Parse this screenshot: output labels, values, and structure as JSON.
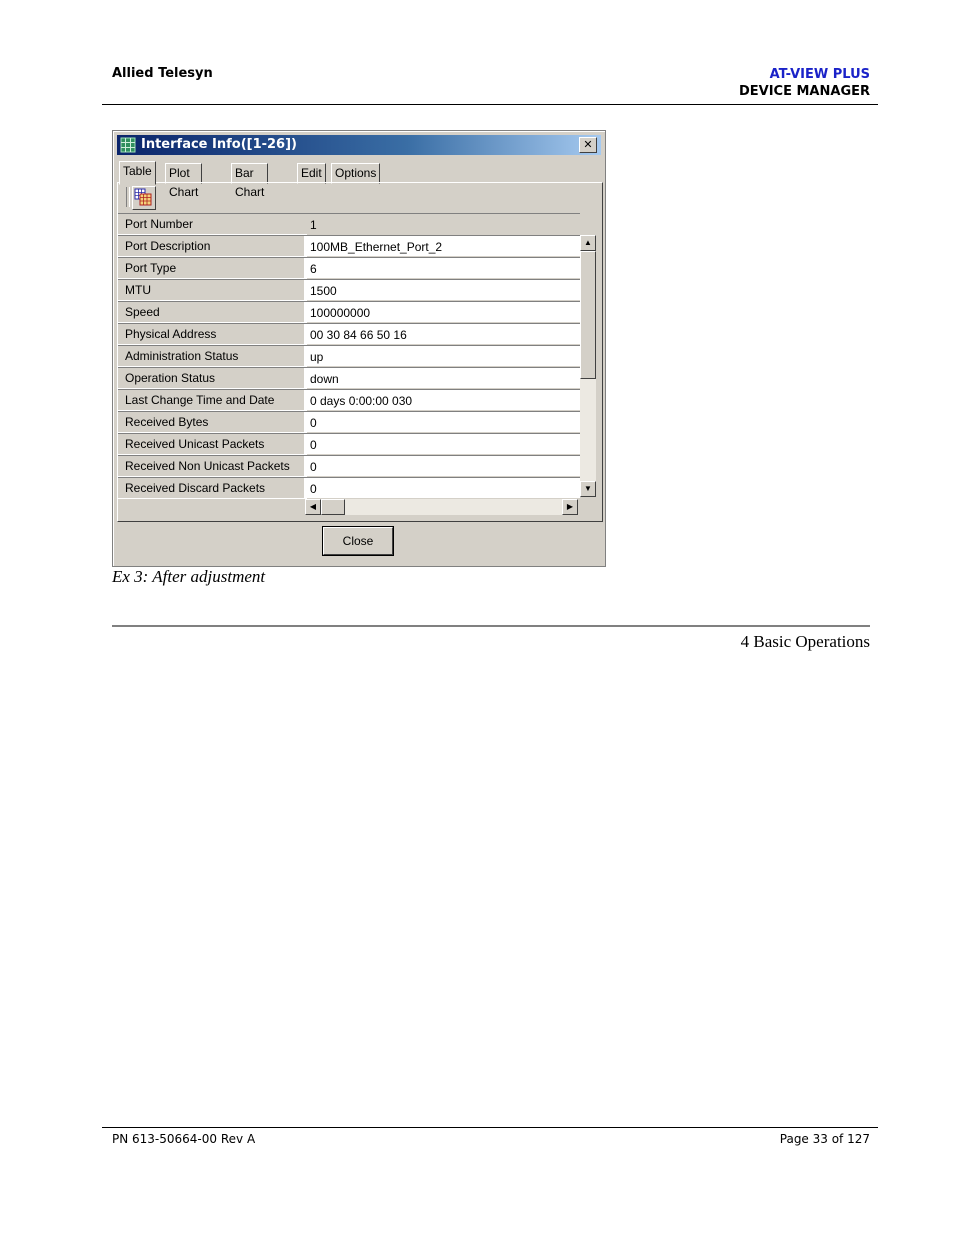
{
  "header": {
    "company": "Allied Telesyn",
    "product": "AT-VIEW PLUS",
    "module": "DEVICE MANAGER",
    "product_color": "#1a22c8"
  },
  "dialog": {
    "title": "Interface Info([1-26])",
    "title_icon": "grid-icon",
    "close_glyph": "✕",
    "tabs": [
      "Table",
      "Plot Chart",
      "Bar Chart",
      "Edit",
      "Options"
    ],
    "active_tab": "Table",
    "toolbar_icon": "table-view-icon",
    "rows": [
      {
        "label": "Port Number",
        "value": "1"
      },
      {
        "label": "Port Description",
        "value": "100MB_Ethernet_Port_2"
      },
      {
        "label": "Port Type",
        "value": "6"
      },
      {
        "label": "MTU",
        "value": "1500"
      },
      {
        "label": "Speed",
        "value": "100000000"
      },
      {
        "label": "Physical Address",
        "value": "00 30 84 66 50 16"
      },
      {
        "label": "Administration Status",
        "value": "up"
      },
      {
        "label": "Operation Status",
        "value": "down"
      },
      {
        "label": "Last Change Time and Date",
        "value": "0 days 0:00:00 030"
      },
      {
        "label": "Received Bytes",
        "value": "0"
      },
      {
        "label": "Received Unicast Packets",
        "value": "0"
      },
      {
        "label": "Received Non Unicast Packets",
        "value": "0"
      },
      {
        "label": "Received Discard Packets",
        "value": "0"
      }
    ],
    "close_label": "Close"
  },
  "caption": "Ex 3: After adjustment",
  "section": "4 Basic Operations",
  "footer": {
    "part_number": "PN 613-50664-00 Rev A",
    "page": "Page 33 of 127"
  }
}
